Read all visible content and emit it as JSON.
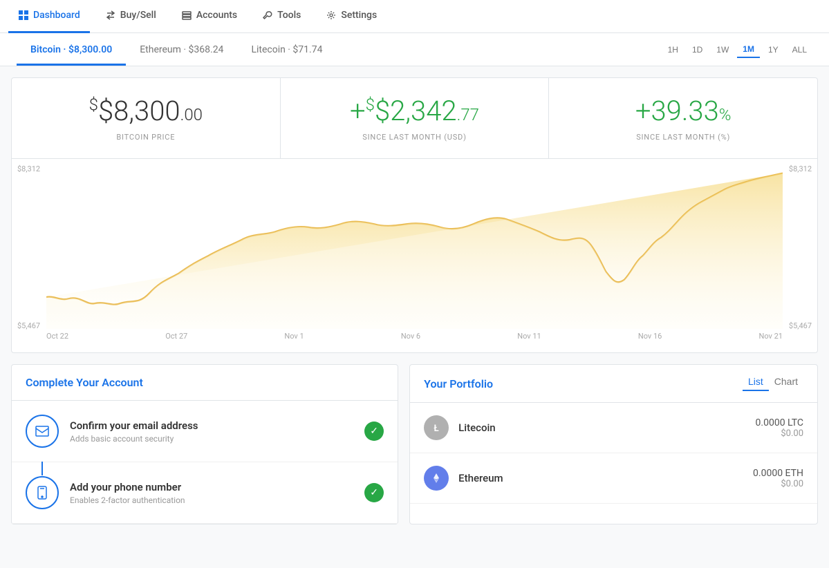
{
  "nav": {
    "items": [
      {
        "id": "dashboard",
        "label": "Dashboard",
        "active": true,
        "icon": "grid"
      },
      {
        "id": "buysell",
        "label": "Buy/Sell",
        "active": false,
        "icon": "arrows"
      },
      {
        "id": "accounts",
        "label": "Accounts",
        "active": false,
        "icon": "layers"
      },
      {
        "id": "tools",
        "label": "Tools",
        "active": false,
        "icon": "wrench"
      },
      {
        "id": "settings",
        "label": "Settings",
        "active": false,
        "icon": "gear"
      }
    ]
  },
  "priceTabs": {
    "tabs": [
      {
        "id": "bitcoin",
        "label": "Bitcoin · $8,300.00",
        "active": true
      },
      {
        "id": "ethereum",
        "label": "Ethereum · $368.24",
        "active": false
      },
      {
        "id": "litecoin",
        "label": "Litecoin · $71.74",
        "active": false
      }
    ],
    "timeFilters": [
      "1H",
      "1D",
      "1W",
      "1M",
      "1Y",
      "ALL"
    ],
    "activeFilter": "1M"
  },
  "stats": {
    "price": {
      "main": "$8,300",
      "cents": ".00",
      "label": "BITCOIN PRICE"
    },
    "usdChange": {
      "sign": "+",
      "main": "$2,342",
      "cents": ".77",
      "label": "SINCE LAST MONTH (USD)"
    },
    "pctChange": {
      "sign": "+",
      "main": "39.33",
      "suffix": "%",
      "label": "SINCE LAST MONTH (%)"
    }
  },
  "chart": {
    "yLow": "$5,467",
    "yHigh": "$8,312",
    "yLowRight": "$5,467",
    "yHighRight": "$8,312",
    "xLabels": [
      "Oct 22",
      "Oct 27",
      "Nov 1",
      "Nov 6",
      "Nov 11",
      "Nov 16",
      "Nov 21"
    ]
  },
  "accountPanel": {
    "title": "Complete Your Account",
    "steps": [
      {
        "id": "email",
        "title": "Confirm your email address",
        "desc": "Adds basic account security",
        "completed": true,
        "icon": "✉"
      },
      {
        "id": "phone",
        "title": "Add your phone number",
        "desc": "Enables 2-factor authentication",
        "completed": true,
        "icon": "📱"
      }
    ]
  },
  "portfolioPanel": {
    "title": "Your Portfolio",
    "views": [
      "List",
      "Chart"
    ],
    "activeView": "List",
    "items": [
      {
        "id": "ltc",
        "name": "Litecoin",
        "amount": "0.0000 LTC",
        "usd": "$0.00",
        "symbol": "Ł",
        "type": "ltc"
      },
      {
        "id": "eth",
        "name": "Ethereum",
        "amount": "0.0000 ETH",
        "usd": "$0.00",
        "symbol": "⬡",
        "type": "eth"
      }
    ]
  }
}
